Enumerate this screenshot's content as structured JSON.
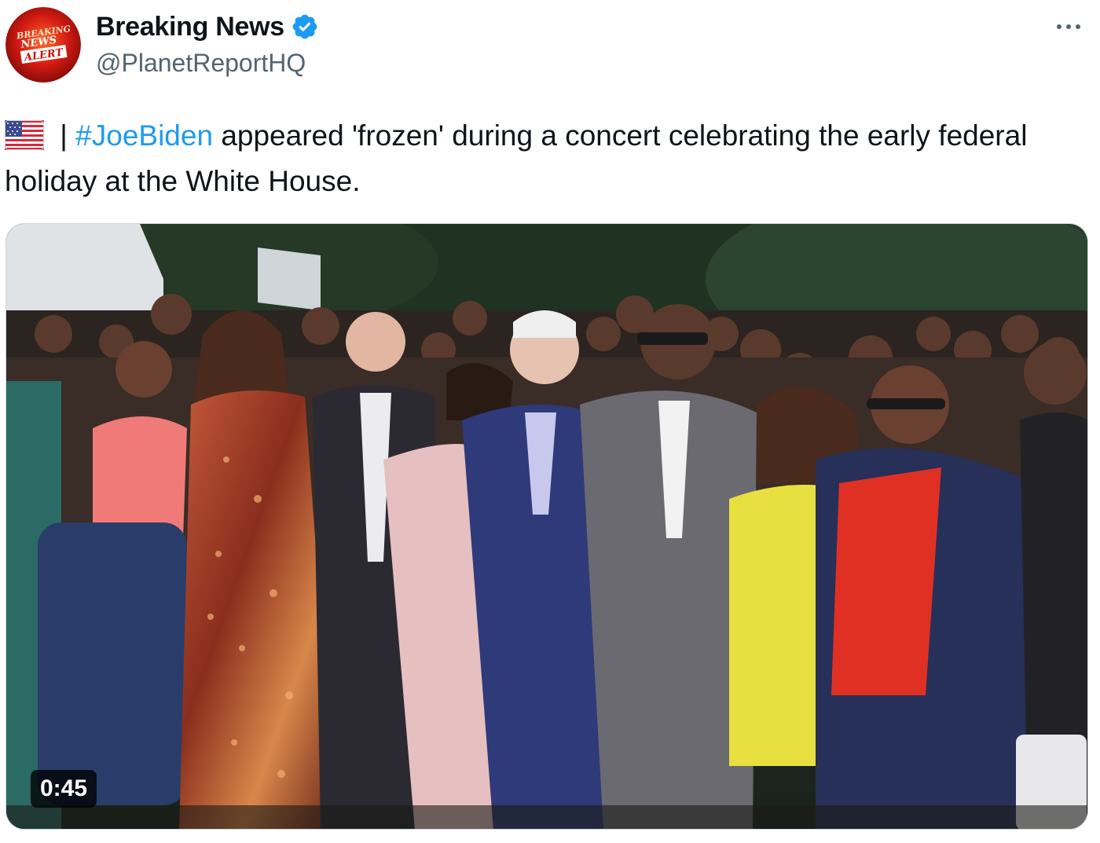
{
  "author": {
    "display_name": "Breaking News",
    "handle": "@PlanetReportHQ",
    "verified": true,
    "avatar_text": [
      "BREAKING",
      "NEWS",
      "ALERT"
    ]
  },
  "tweet": {
    "flag_icon": "us-flag-icon",
    "separator": " | ",
    "hashtag": "#JoeBiden",
    "body": " appeared 'frozen' during a concert celebrating the early federal holiday at the White House."
  },
  "media": {
    "duration": "0:45"
  },
  "colors": {
    "accent": "#1d9bf0",
    "muted": "#536471",
    "text": "#0f1419"
  }
}
